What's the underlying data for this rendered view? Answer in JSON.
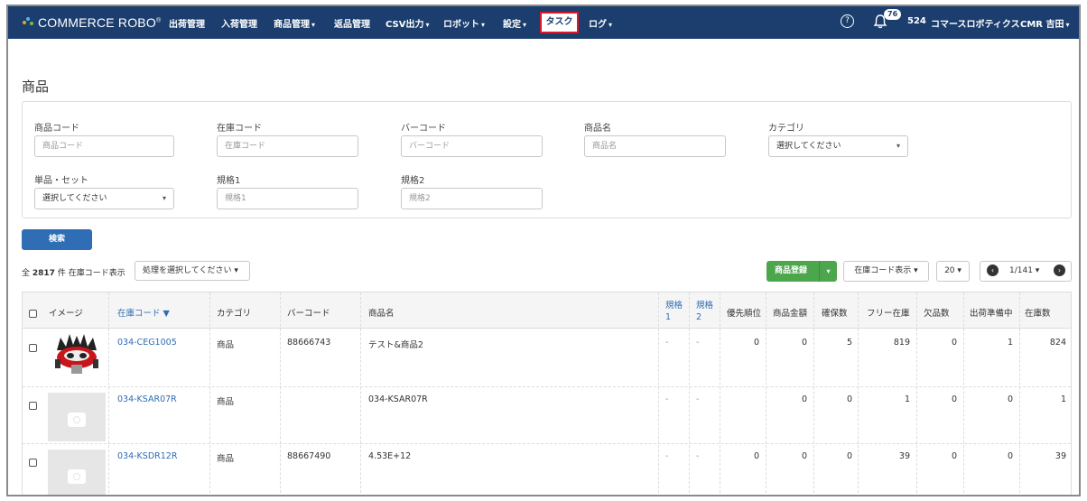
{
  "nav": {
    "logo": "COMMERCE ROBO",
    "logo_mark": "®",
    "items": [
      "出荷管理",
      "入荷管理",
      "商品管理",
      "返品管理",
      "CSV出力",
      "ロボット",
      "設定",
      "タスク",
      "ログ"
    ],
    "help_icon": "?",
    "notification_count": "76",
    "company_code": "524",
    "company_name": "コマースロボティクス",
    "user": "CMR 吉田"
  },
  "page": {
    "title": "商品"
  },
  "filters": {
    "product_code": {
      "label": "商品コード",
      "placeholder": "商品コード"
    },
    "stock_code": {
      "label": "在庫コード",
      "placeholder": "在庫コード"
    },
    "barcode": {
      "label": "バーコード",
      "placeholder": "バーコード"
    },
    "product_name": {
      "label": "商品名",
      "placeholder": "商品名"
    },
    "category": {
      "label": "カテゴリ",
      "value": "選択してください"
    },
    "single_set": {
      "label": "単品・セット",
      "value": "選択してください"
    },
    "spec1": {
      "label": "規格1",
      "placeholder": "規格1"
    },
    "spec2": {
      "label": "規格2",
      "placeholder": "規格2"
    }
  },
  "search_button": "検索",
  "list": {
    "count_prefix": "全",
    "count": "2817",
    "count_suffix": "件 在庫コード表示",
    "bulk_action": "処理を選択してください",
    "register_button": "商品登録",
    "display_mode": "在庫コード表示",
    "per_page": "20",
    "page": "1/141"
  },
  "table": {
    "headers": {
      "image": "イメージ",
      "stock_code": "在庫コード ▼",
      "category": "カテゴリ",
      "barcode": "バーコード",
      "name": "商品名",
      "spec1_a": "規格",
      "spec1_b": "1",
      "spec2_a": "規格",
      "spec2_b": "2",
      "priority": "優先順位",
      "price": "商品金額",
      "reserved": "確保数",
      "free_stock": "フリー在庫",
      "shortage": "欠品数",
      "preparing": "出荷準備中",
      "stock": "在庫数"
    },
    "rows": [
      {
        "stock_code": "034-CEG1005",
        "category": "商品",
        "barcode": "88666743",
        "name": "テスト&商品2",
        "spec1": "-",
        "spec2": "-",
        "priority": "0",
        "price": "0",
        "reserved": "5",
        "free_stock": "819",
        "shortage": "0",
        "preparing": "1",
        "stock": "824"
      },
      {
        "stock_code": "034-KSAR07R",
        "category": "商品",
        "barcode": "",
        "name": "034-KSAR07R",
        "spec1": "-",
        "spec2": "-",
        "priority": "",
        "price": "0",
        "reserved": "0",
        "free_stock": "1",
        "shortage": "0",
        "preparing": "0",
        "stock": "1"
      },
      {
        "stock_code": "034-KSDR12R",
        "category": "商品",
        "barcode": "88667490",
        "name": "4.53E+12",
        "spec1": "-",
        "spec2": "-",
        "priority": "0",
        "price": "0",
        "reserved": "0",
        "free_stock": "39",
        "shortage": "0",
        "preparing": "0",
        "stock": "39"
      }
    ]
  },
  "colors": {
    "nav_bg": "#1b3e6e",
    "link": "#2f6db5",
    "primary": "#2f6db5",
    "success": "#4ca64c",
    "highlight": "#d9182a"
  }
}
